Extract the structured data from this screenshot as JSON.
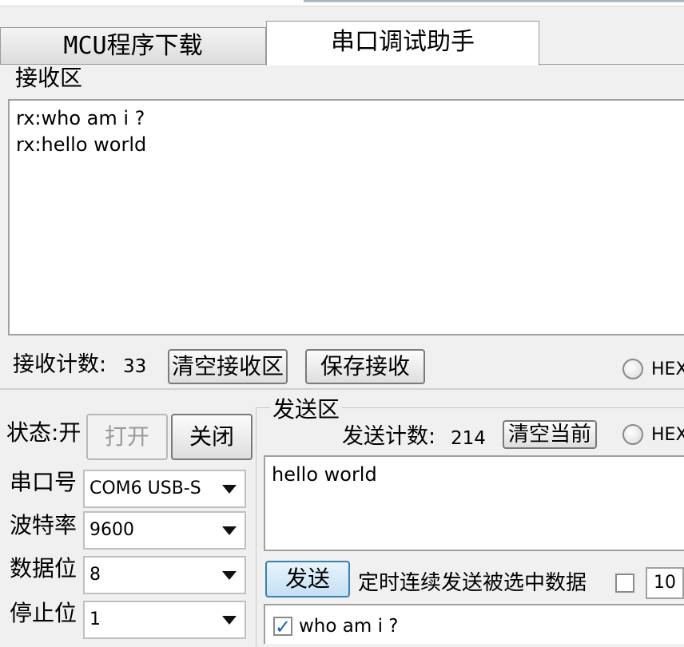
{
  "tabs": [
    {
      "label": "MCU程序下载",
      "active": false
    },
    {
      "label": "串口调试助手",
      "active": true
    }
  ],
  "receive": {
    "group_label": "接收区",
    "lines": [
      "rx:who am i ?",
      "rx:hello world"
    ],
    "count_label": "接收计数:",
    "count_value": "33",
    "clear_button": "清空接收区",
    "save_button": "保存接收",
    "hex_label": "HEX"
  },
  "port": {
    "status_label": "状态:开",
    "open_button": "打开",
    "close_button": "关闭",
    "port_label": "串口号",
    "port_value": "COM6  USB-S",
    "baud_label": "波特率",
    "baud_value": "9600",
    "databits_label": "数据位",
    "databits_value": "8",
    "stopbits_label": "停止位",
    "stopbits_value": "1"
  },
  "send": {
    "group_label": "发送区",
    "count_label": "发送计数:",
    "count_value": "214",
    "clear_button": "清空当前",
    "hex_label": "HEX",
    "text": "hello world",
    "send_button": "发送",
    "timed_label": "定时连续发送被选中数据",
    "interval_value": "10",
    "list_items": [
      {
        "label": "who am i ?",
        "checked": true
      }
    ]
  }
}
